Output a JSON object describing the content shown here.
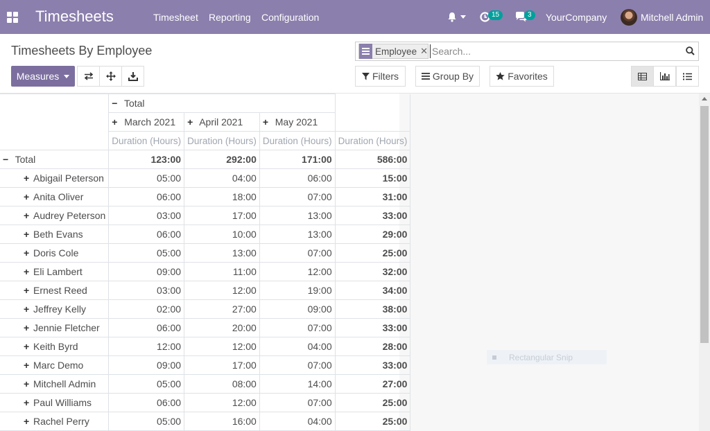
{
  "navbar": {
    "brand": "Timesheets",
    "menu": [
      "Timesheet",
      "Reporting",
      "Configuration"
    ],
    "activity_count": "15",
    "message_count": "3",
    "company": "YourCompany",
    "user": "Mitchell Admin",
    "bg_color": "#8b7fad"
  },
  "page": {
    "title": "Timesheets By Employee"
  },
  "search": {
    "facet_label": "Employee",
    "placeholder": "Search..."
  },
  "toolbar": {
    "measures_label": "Measures",
    "filters_label": "Filters",
    "groupby_label": "Group By",
    "favorites_label": "Favorites",
    "icons": [
      "flip-axis-icon",
      "expand-all-icon",
      "download-icon"
    ],
    "view_icons": [
      "pivot-view-icon",
      "graph-view-icon",
      "list-view-icon"
    ]
  },
  "pivot": {
    "total_label": "Total",
    "columns": [
      "March 2021",
      "April 2021",
      "May 2021"
    ],
    "measure_label": "Duration (Hours)",
    "totals_row": [
      "123:00",
      "292:00",
      "171:00",
      "586:00"
    ],
    "rows": [
      {
        "name": "Abigail Peterson",
        "values": [
          "05:00",
          "04:00",
          "06:00"
        ],
        "total": "15:00"
      },
      {
        "name": "Anita Oliver",
        "values": [
          "06:00",
          "18:00",
          "07:00"
        ],
        "total": "31:00"
      },
      {
        "name": "Audrey Peterson",
        "values": [
          "03:00",
          "17:00",
          "13:00"
        ],
        "total": "33:00"
      },
      {
        "name": "Beth Evans",
        "values": [
          "06:00",
          "10:00",
          "13:00"
        ],
        "total": "29:00"
      },
      {
        "name": "Doris Cole",
        "values": [
          "05:00",
          "13:00",
          "07:00"
        ],
        "total": "25:00"
      },
      {
        "name": "Eli Lambert",
        "values": [
          "09:00",
          "11:00",
          "12:00"
        ],
        "total": "32:00"
      },
      {
        "name": "Ernest Reed",
        "values": [
          "03:00",
          "12:00",
          "19:00"
        ],
        "total": "34:00"
      },
      {
        "name": "Jeffrey Kelly",
        "values": [
          "02:00",
          "27:00",
          "09:00"
        ],
        "total": "38:00"
      },
      {
        "name": "Jennie Fletcher",
        "values": [
          "06:00",
          "20:00",
          "07:00"
        ],
        "total": "33:00"
      },
      {
        "name": "Keith Byrd",
        "values": [
          "12:00",
          "12:00",
          "04:00"
        ],
        "total": "28:00"
      },
      {
        "name": "Marc Demo",
        "values": [
          "09:00",
          "17:00",
          "07:00"
        ],
        "total": "33:00"
      },
      {
        "name": "Mitchell Admin",
        "values": [
          "05:00",
          "08:00",
          "14:00"
        ],
        "total": "27:00"
      },
      {
        "name": "Paul Williams",
        "values": [
          "06:00",
          "12:00",
          "07:00"
        ],
        "total": "25:00"
      },
      {
        "name": "Rachel Perry",
        "values": [
          "05:00",
          "16:00",
          "04:00"
        ],
        "total": "25:00"
      }
    ]
  },
  "overlay": {
    "snip_label": "Rectangular Snip"
  }
}
